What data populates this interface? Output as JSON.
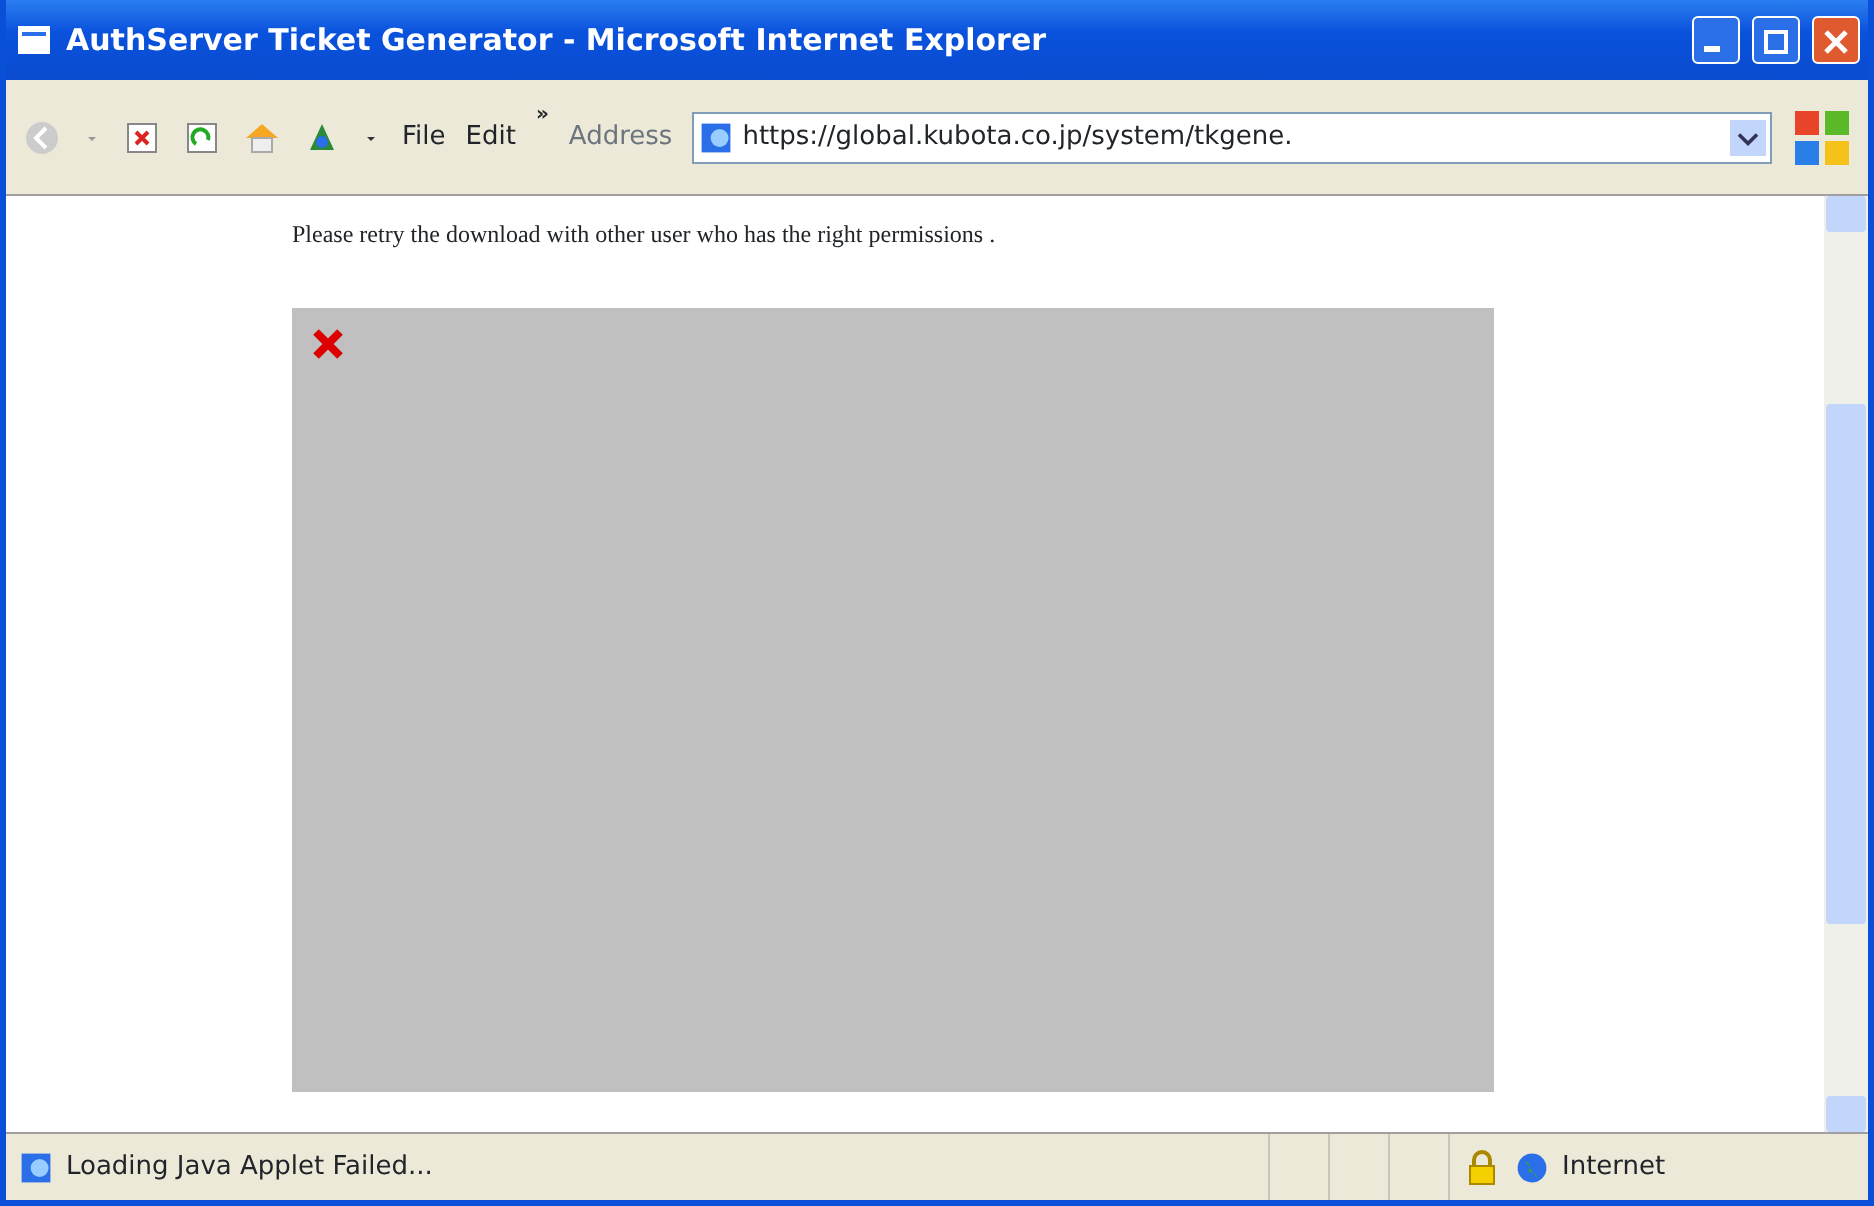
{
  "window": {
    "title": "AuthServer Ticket Generator - Microsoft Internet Explorer"
  },
  "menu": [
    {
      "label": "File"
    },
    {
      "label": "Edit"
    }
  ],
  "menu_overflow": "»",
  "address": {
    "label": "Address",
    "value": "https://global.kubota.co.jp/system/tkgene."
  },
  "content": {
    "message": "Please retry the download with other user who has the right permissions .",
    "applet": {
      "broken": true
    }
  },
  "status_bar": {
    "text": "Loading Java Applet Failed...",
    "secure": true,
    "zone": "Internet"
  }
}
